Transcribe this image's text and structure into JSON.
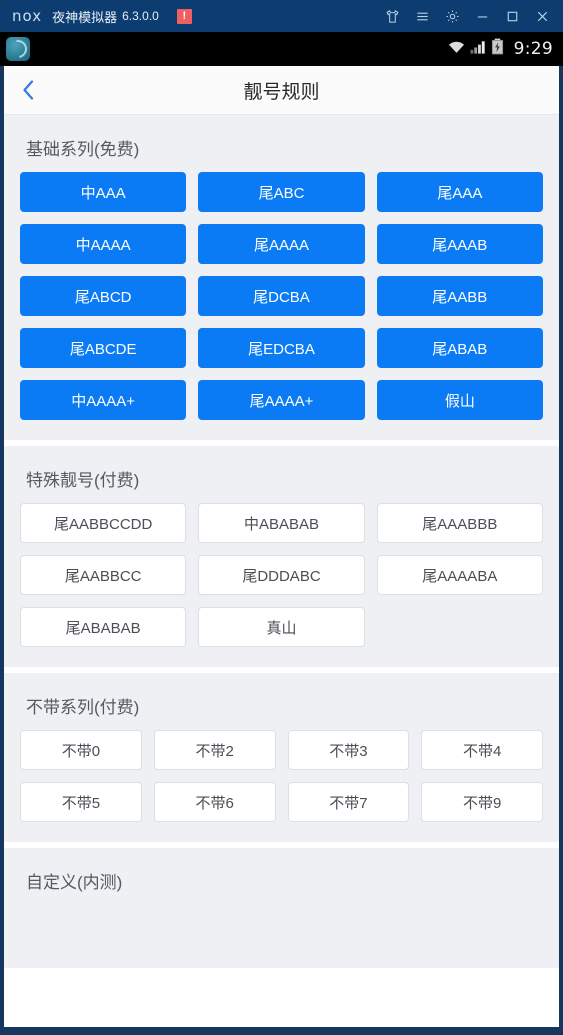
{
  "titlebar": {
    "logo": "nox",
    "app_name": "夜神模拟器",
    "version": "6.3.0.0",
    "warning_badge": "!",
    "controls": [
      {
        "name": "theme-shirt-icon",
        "label": "主题"
      },
      {
        "name": "menu-icon",
        "label": "菜单"
      },
      {
        "name": "gear-icon",
        "label": "设置"
      },
      {
        "name": "minimize-icon",
        "label": "最小化"
      },
      {
        "name": "maximize-icon",
        "label": "最大化"
      },
      {
        "name": "close-icon",
        "label": "关闭"
      }
    ]
  },
  "statusbar": {
    "wifi": "wifi-icon",
    "signal": "signal-icon",
    "battery": "battery-charging-icon",
    "time": "9:29"
  },
  "nav": {
    "back_label": "‹",
    "title": "靓号规则"
  },
  "colors": {
    "accent_blue": "#0b7bf5",
    "titlebar_navy": "#0d3c70",
    "window_border": "#16365e",
    "page_bg": "#eef0f3",
    "badge_red": "#ef5f62"
  },
  "sections": [
    {
      "title": "基础系列(免费)",
      "style": "blue",
      "columns": 3,
      "buttons": [
        "中AAA",
        "尾ABC",
        "尾AAA",
        "中AAAA",
        "尾AAAA",
        "尾AAAB",
        "尾ABCD",
        "尾DCBA",
        "尾AABB",
        "尾ABCDE",
        "尾EDCBA",
        "尾ABAB",
        "中AAAA+",
        "尾AAAA+",
        "假山"
      ]
    },
    {
      "title": "特殊靓号(付费)",
      "style": "white",
      "columns": 3,
      "buttons": [
        "尾AABBCCDD",
        "中ABABAB",
        "尾AAABBB",
        "尾AABBCC",
        "尾DDDABC",
        "尾AAAABA",
        "尾ABABAB",
        "真山"
      ]
    },
    {
      "title": "不带系列(付费)",
      "style": "white",
      "columns": 4,
      "buttons": [
        "不带0",
        "不带2",
        "不带3",
        "不带4",
        "不带5",
        "不带6",
        "不带7",
        "不带9"
      ]
    },
    {
      "title": "自定义(内测)",
      "style": "white",
      "columns": 3,
      "buttons": []
    }
  ]
}
